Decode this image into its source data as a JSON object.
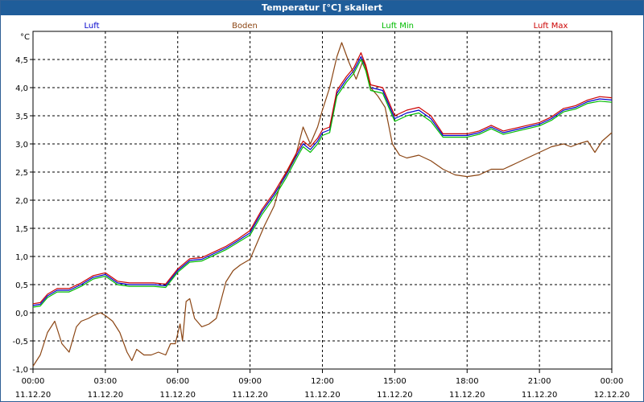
{
  "window": {
    "title": "Temperatur [°C] skaliert"
  },
  "chart_data": {
    "type": "line",
    "title": "Temperatur [°C] skaliert",
    "ylabel": "°C",
    "ylim": [
      -1.0,
      5.0
    ],
    "xlim_hours": [
      0,
      24
    ],
    "yticks": [
      "-1,0",
      "-0,5",
      "0,0",
      "0,5",
      "1,0",
      "1,5",
      "2,0",
      "2,5",
      "3,0",
      "3,5",
      "4,0",
      "4,5"
    ],
    "xticks": [
      {
        "time": "00:00",
        "date": "11.12.20"
      },
      {
        "time": "03:00",
        "date": "11.12.20"
      },
      {
        "time": "06:00",
        "date": "11.12.20"
      },
      {
        "time": "09:00",
        "date": "11.12.20"
      },
      {
        "time": "12:00",
        "date": "11.12.20"
      },
      {
        "time": "15:00",
        "date": "11.12.20"
      },
      {
        "time": "18:00",
        "date": "11.12.20"
      },
      {
        "time": "21:00",
        "date": "11.12.20"
      },
      {
        "time": "00:00",
        "date": "12.12.20"
      }
    ],
    "grid": true,
    "legend_position": "top",
    "series": [
      {
        "name": "Luft",
        "color": "#0000cc",
        "x": [
          0,
          0.3,
          0.6,
          1,
          1.5,
          2,
          2.5,
          3,
          3.5,
          4,
          4.5,
          5,
          5.5,
          6,
          6.5,
          7,
          7.5,
          8,
          8.5,
          9,
          9.5,
          10,
          10.5,
          11,
          11.2,
          11.5,
          11.8,
          12,
          12.3,
          12.6,
          13,
          13.3,
          13.6,
          13.8,
          14,
          14.5,
          15,
          15.5,
          16,
          16.5,
          17,
          17.5,
          18,
          18.5,
          19,
          19.5,
          20,
          20.5,
          21,
          21.5,
          22,
          22.5,
          23,
          23.5,
          24
        ],
        "y": [
          0.13,
          0.15,
          0.3,
          0.4,
          0.4,
          0.5,
          0.63,
          0.68,
          0.53,
          0.5,
          0.5,
          0.5,
          0.48,
          0.75,
          0.93,
          0.95,
          1.05,
          1.15,
          1.28,
          1.42,
          1.8,
          2.1,
          2.45,
          2.85,
          3.0,
          2.9,
          3.05,
          3.2,
          3.25,
          3.9,
          4.15,
          4.3,
          4.55,
          4.35,
          4.0,
          3.95,
          3.45,
          3.55,
          3.6,
          3.45,
          3.15,
          3.15,
          3.15,
          3.2,
          3.3,
          3.2,
          3.25,
          3.3,
          3.35,
          3.45,
          3.6,
          3.65,
          3.75,
          3.8,
          3.78
        ]
      },
      {
        "name": "Boden",
        "color": "#8b4513",
        "x": [
          0,
          0.3,
          0.6,
          0.9,
          1.2,
          1.5,
          1.8,
          2,
          2.3,
          2.5,
          2.8,
          3,
          3.3,
          3.6,
          3.9,
          4.1,
          4.3,
          4.6,
          4.9,
          5.2,
          5.5,
          5.7,
          5.9,
          6.1,
          6.2,
          6.35,
          6.5,
          6.7,
          7,
          7.3,
          7.6,
          8,
          8.3,
          8.6,
          9,
          9.3,
          9.6,
          10,
          10.3,
          10.6,
          10.9,
          11.2,
          11.5,
          11.8,
          12,
          12.3,
          12.6,
          12.8,
          13.1,
          13.4,
          13.7,
          14,
          14.3,
          14.6,
          14.9,
          15.2,
          15.5,
          16,
          16.5,
          17,
          17.5,
          18,
          18.5,
          19,
          19.5,
          20,
          20.5,
          21,
          21.5,
          22,
          22.3,
          22.6,
          23,
          23.3,
          23.6,
          24
        ],
        "y": [
          -0.95,
          -0.75,
          -0.35,
          -0.15,
          -0.55,
          -0.7,
          -0.25,
          -0.15,
          -0.1,
          -0.05,
          0.0,
          -0.05,
          -0.15,
          -0.35,
          -0.7,
          -0.85,
          -0.65,
          -0.75,
          -0.75,
          -0.7,
          -0.75,
          -0.55,
          -0.55,
          -0.2,
          -0.5,
          0.2,
          0.25,
          -0.1,
          -0.25,
          -0.2,
          -0.1,
          0.55,
          0.75,
          0.85,
          0.95,
          1.25,
          1.55,
          1.9,
          2.35,
          2.55,
          2.8,
          3.3,
          3.0,
          3.3,
          3.6,
          4.0,
          4.55,
          4.8,
          4.45,
          4.15,
          4.5,
          4.0,
          3.85,
          3.65,
          3.0,
          2.8,
          2.75,
          2.8,
          2.7,
          2.55,
          2.45,
          2.42,
          2.45,
          2.55,
          2.55,
          2.65,
          2.75,
          2.85,
          2.95,
          3.0,
          2.95,
          3.0,
          3.05,
          2.85,
          3.05,
          3.2
        ]
      },
      {
        "name": "Luft Min",
        "color": "#00bb00",
        "x": [
          0,
          0.3,
          0.6,
          1,
          1.5,
          2,
          2.5,
          3,
          3.5,
          4,
          4.5,
          5,
          5.5,
          6,
          6.5,
          7,
          7.5,
          8,
          8.5,
          9,
          9.5,
          10,
          10.5,
          11,
          11.2,
          11.5,
          11.8,
          12,
          12.3,
          12.6,
          13,
          13.3,
          13.6,
          13.8,
          14,
          14.5,
          15,
          15.5,
          16,
          16.5,
          17,
          17.5,
          18,
          18.5,
          19,
          19.5,
          20,
          20.5,
          21,
          21.5,
          22,
          22.5,
          23,
          23.5,
          24
        ],
        "y": [
          0.1,
          0.12,
          0.27,
          0.37,
          0.37,
          0.47,
          0.6,
          0.65,
          0.5,
          0.47,
          0.47,
          0.47,
          0.45,
          0.72,
          0.9,
          0.92,
          1.02,
          1.12,
          1.25,
          1.38,
          1.75,
          2.05,
          2.4,
          2.8,
          2.95,
          2.85,
          3.0,
          3.15,
          3.2,
          3.85,
          4.1,
          4.25,
          4.5,
          4.3,
          3.95,
          3.9,
          3.4,
          3.5,
          3.55,
          3.4,
          3.12,
          3.12,
          3.12,
          3.17,
          3.27,
          3.17,
          3.22,
          3.27,
          3.32,
          3.42,
          3.57,
          3.62,
          3.72,
          3.76,
          3.74
        ]
      },
      {
        "name": "Luft Max",
        "color": "#cc0000",
        "x": [
          0,
          0.3,
          0.6,
          1,
          1.5,
          2,
          2.5,
          3,
          3.5,
          4,
          4.5,
          5,
          5.5,
          6,
          6.5,
          7,
          7.5,
          8,
          8.5,
          9,
          9.5,
          10,
          10.5,
          11,
          11.2,
          11.5,
          11.8,
          12,
          12.3,
          12.6,
          13,
          13.3,
          13.6,
          13.8,
          14,
          14.5,
          15,
          15.5,
          16,
          16.5,
          17,
          17.5,
          18,
          18.5,
          19,
          19.5,
          20,
          20.5,
          21,
          21.5,
          22,
          22.5,
          23,
          23.5,
          24
        ],
        "y": [
          0.16,
          0.18,
          0.33,
          0.43,
          0.43,
          0.53,
          0.66,
          0.71,
          0.56,
          0.53,
          0.53,
          0.53,
          0.51,
          0.78,
          0.96,
          0.98,
          1.08,
          1.18,
          1.31,
          1.46,
          1.84,
          2.14,
          2.5,
          2.9,
          3.05,
          2.95,
          3.1,
          3.25,
          3.3,
          3.95,
          4.2,
          4.35,
          4.62,
          4.4,
          4.05,
          4.0,
          3.5,
          3.6,
          3.65,
          3.5,
          3.18,
          3.18,
          3.18,
          3.23,
          3.33,
          3.23,
          3.28,
          3.33,
          3.38,
          3.48,
          3.63,
          3.68,
          3.78,
          3.84,
          3.82
        ]
      }
    ]
  }
}
